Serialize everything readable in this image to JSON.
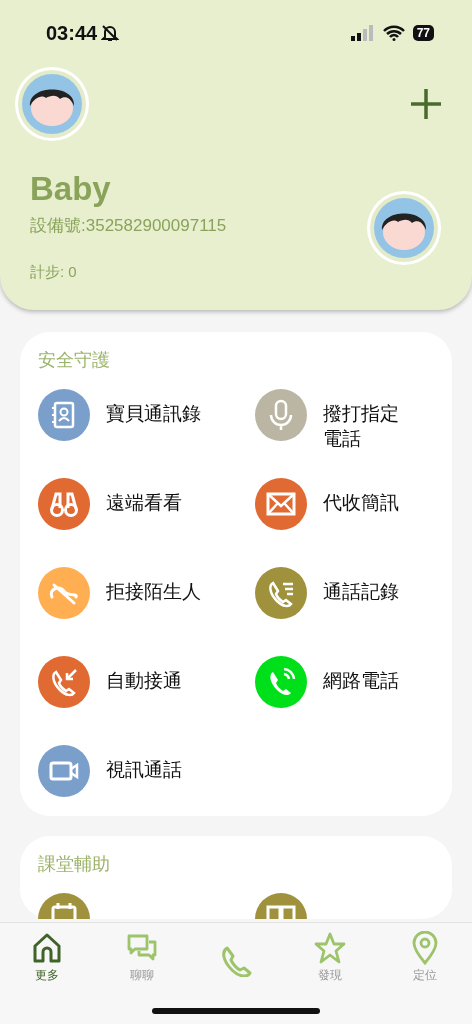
{
  "status_bar": {
    "time": "03:44",
    "battery": "77"
  },
  "header": {
    "name": "Baby",
    "device_id": "設備號:352582900097115",
    "steps": "計步: 0"
  },
  "sections": [
    {
      "title": "安全守護",
      "items": [
        {
          "label": "寶貝通訊錄",
          "color": "#7b9fcb",
          "kind": "contacts"
        },
        {
          "label": "撥打指定電話",
          "color": "#bbb6a3",
          "kind": "mic"
        },
        {
          "label": "遠端看看",
          "color": "#e06a32",
          "kind": "binoculars"
        },
        {
          "label": "代收簡訊",
          "color": "#e06a32",
          "kind": "mail"
        },
        {
          "label": "拒接陌生人",
          "color": "#ffaf52",
          "kind": "reject"
        },
        {
          "label": "通話記錄",
          "color": "#a0913c",
          "kind": "calllog"
        },
        {
          "label": "自動接通",
          "color": "#e06a32",
          "kind": "incoming"
        },
        {
          "label": "網路電話",
          "color": "#00e01a",
          "kind": "netcall"
        },
        {
          "label": "視訊通話",
          "color": "#7b9fcb",
          "kind": "video"
        }
      ]
    },
    {
      "title": "課堂輔助",
      "items": [
        {
          "color": "#a0913c",
          "kind": "calendar"
        },
        {
          "color": "#a0913c",
          "kind": "book"
        }
      ]
    }
  ],
  "tab_bar": [
    {
      "label": "更多",
      "selected": true,
      "kind": "home"
    },
    {
      "label": "聊聊",
      "selected": false,
      "kind": "chat"
    },
    {
      "selected": false,
      "kind": "phone"
    },
    {
      "label": "發現",
      "selected": false,
      "kind": "star"
    },
    {
      "label": "定位",
      "selected": false,
      "kind": "pin"
    }
  ]
}
